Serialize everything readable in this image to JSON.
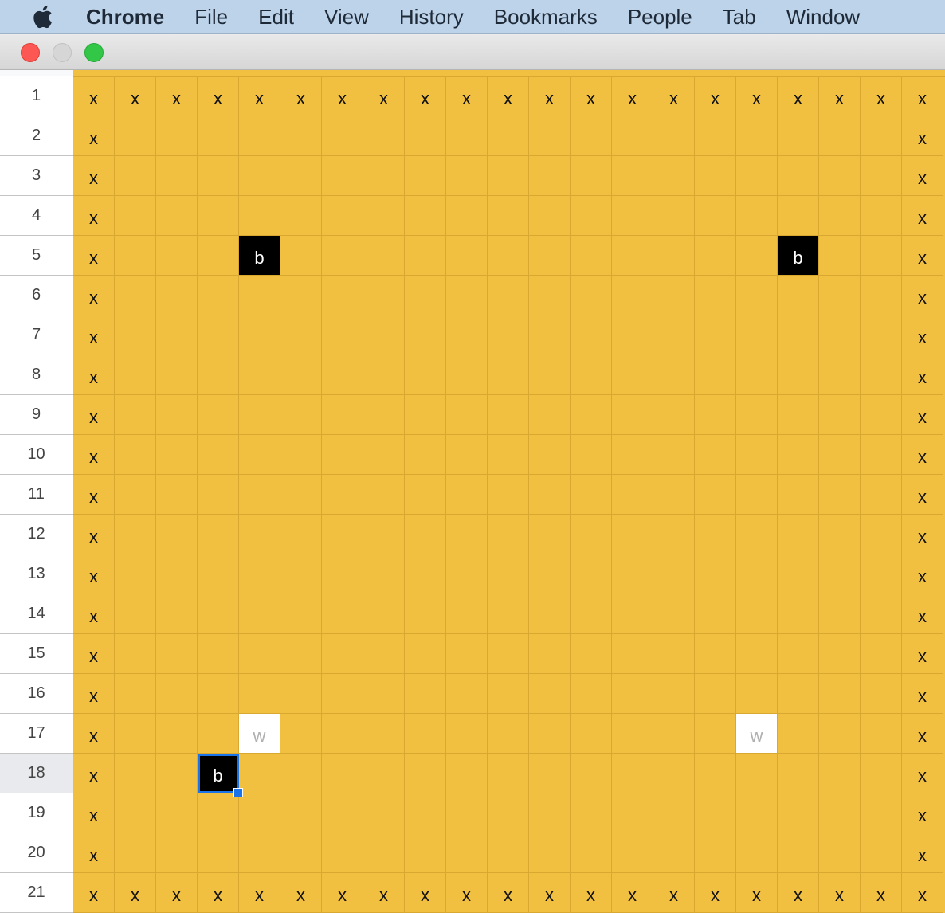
{
  "menubar": {
    "app_name": "Chrome",
    "items": [
      "File",
      "Edit",
      "View",
      "History",
      "Bookmarks",
      "People",
      "Tab",
      "Window"
    ]
  },
  "colors": {
    "cell_fill": "#f1c040",
    "grid_line": "#d8a830",
    "black_cell": "#000000",
    "white_cell": "#ffffff",
    "selection": "#1a73e8"
  },
  "sheet": {
    "rows": [
      [
        "x",
        "x",
        "x",
        "x",
        "x",
        "x",
        "x",
        "x",
        "x",
        "x",
        "x",
        "x",
        "x",
        "x",
        "x",
        "x",
        "x",
        "x",
        "x",
        "x",
        "x"
      ],
      [
        "x",
        "",
        "",
        "",
        "",
        "",
        "",
        "",
        "",
        "",
        "",
        "",
        "",
        "",
        "",
        "",
        "",
        "",
        "",
        "",
        "x"
      ],
      [
        "x",
        "",
        "",
        "",
        "",
        "",
        "",
        "",
        "",
        "",
        "",
        "",
        "",
        "",
        "",
        "",
        "",
        "",
        "",
        "",
        "x"
      ],
      [
        "x",
        "",
        "",
        "",
        "",
        "",
        "",
        "",
        "",
        "",
        "",
        "",
        "",
        "",
        "",
        "",
        "",
        "",
        "",
        "",
        "x"
      ],
      [
        "x",
        "",
        "",
        "",
        "b",
        "",
        "",
        "",
        "",
        "",
        "",
        "",
        "",
        "",
        "",
        "",
        "",
        "b",
        "",
        "",
        "x"
      ],
      [
        "x",
        "",
        "",
        "",
        "",
        "",
        "",
        "",
        "",
        "",
        "",
        "",
        "",
        "",
        "",
        "",
        "",
        "",
        "",
        "",
        "x"
      ],
      [
        "x",
        "",
        "",
        "",
        "",
        "",
        "",
        "",
        "",
        "",
        "",
        "",
        "",
        "",
        "",
        "",
        "",
        "",
        "",
        "",
        "x"
      ],
      [
        "x",
        "",
        "",
        "",
        "",
        "",
        "",
        "",
        "",
        "",
        "",
        "",
        "",
        "",
        "",
        "",
        "",
        "",
        "",
        "",
        "x"
      ],
      [
        "x",
        "",
        "",
        "",
        "",
        "",
        "",
        "",
        "",
        "",
        "",
        "",
        "",
        "",
        "",
        "",
        "",
        "",
        "",
        "",
        "x"
      ],
      [
        "x",
        "",
        "",
        "",
        "",
        "",
        "",
        "",
        "",
        "",
        "",
        "",
        "",
        "",
        "",
        "",
        "",
        "",
        "",
        "",
        "x"
      ],
      [
        "x",
        "",
        "",
        "",
        "",
        "",
        "",
        "",
        "",
        "",
        "",
        "",
        "",
        "",
        "",
        "",
        "",
        "",
        "",
        "",
        "x"
      ],
      [
        "x",
        "",
        "",
        "",
        "",
        "",
        "",
        "",
        "",
        "",
        "",
        "",
        "",
        "",
        "",
        "",
        "",
        "",
        "",
        "",
        "x"
      ],
      [
        "x",
        "",
        "",
        "",
        "",
        "",
        "",
        "",
        "",
        "",
        "",
        "",
        "",
        "",
        "",
        "",
        "",
        "",
        "",
        "",
        "x"
      ],
      [
        "x",
        "",
        "",
        "",
        "",
        "",
        "",
        "",
        "",
        "",
        "",
        "",
        "",
        "",
        "",
        "",
        "",
        "",
        "",
        "",
        "x"
      ],
      [
        "x",
        "",
        "",
        "",
        "",
        "",
        "",
        "",
        "",
        "",
        "",
        "",
        "",
        "",
        "",
        "",
        "",
        "",
        "",
        "",
        "x"
      ],
      [
        "x",
        "",
        "",
        "",
        "",
        "",
        "",
        "",
        "",
        "",
        "",
        "",
        "",
        "",
        "",
        "",
        "",
        "",
        "",
        "",
        "x"
      ],
      [
        "x",
        "",
        "",
        "",
        "w",
        "",
        "",
        "",
        "",
        "",
        "",
        "",
        "",
        "",
        "",
        "",
        "w",
        "",
        "",
        "",
        "x"
      ],
      [
        "x",
        "",
        "",
        "b",
        "",
        "",
        "",
        "",
        "",
        "",
        "",
        "",
        "",
        "",
        "",
        "",
        "",
        "",
        "",
        "",
        "x"
      ],
      [
        "x",
        "",
        "",
        "",
        "",
        "",
        "",
        "",
        "",
        "",
        "",
        "",
        "",
        "",
        "",
        "",
        "",
        "",
        "",
        "",
        "x"
      ],
      [
        "x",
        "",
        "",
        "",
        "",
        "",
        "",
        "",
        "",
        "",
        "",
        "",
        "",
        "",
        "",
        "",
        "",
        "",
        "",
        "",
        "x"
      ],
      [
        "x",
        "x",
        "x",
        "x",
        "x",
        "x",
        "x",
        "x",
        "x",
        "x",
        "x",
        "x",
        "x",
        "x",
        "x",
        "x",
        "x",
        "x",
        "x",
        "x",
        "x"
      ]
    ],
    "active_cell": {
      "row": 18,
      "col": 4
    }
  }
}
